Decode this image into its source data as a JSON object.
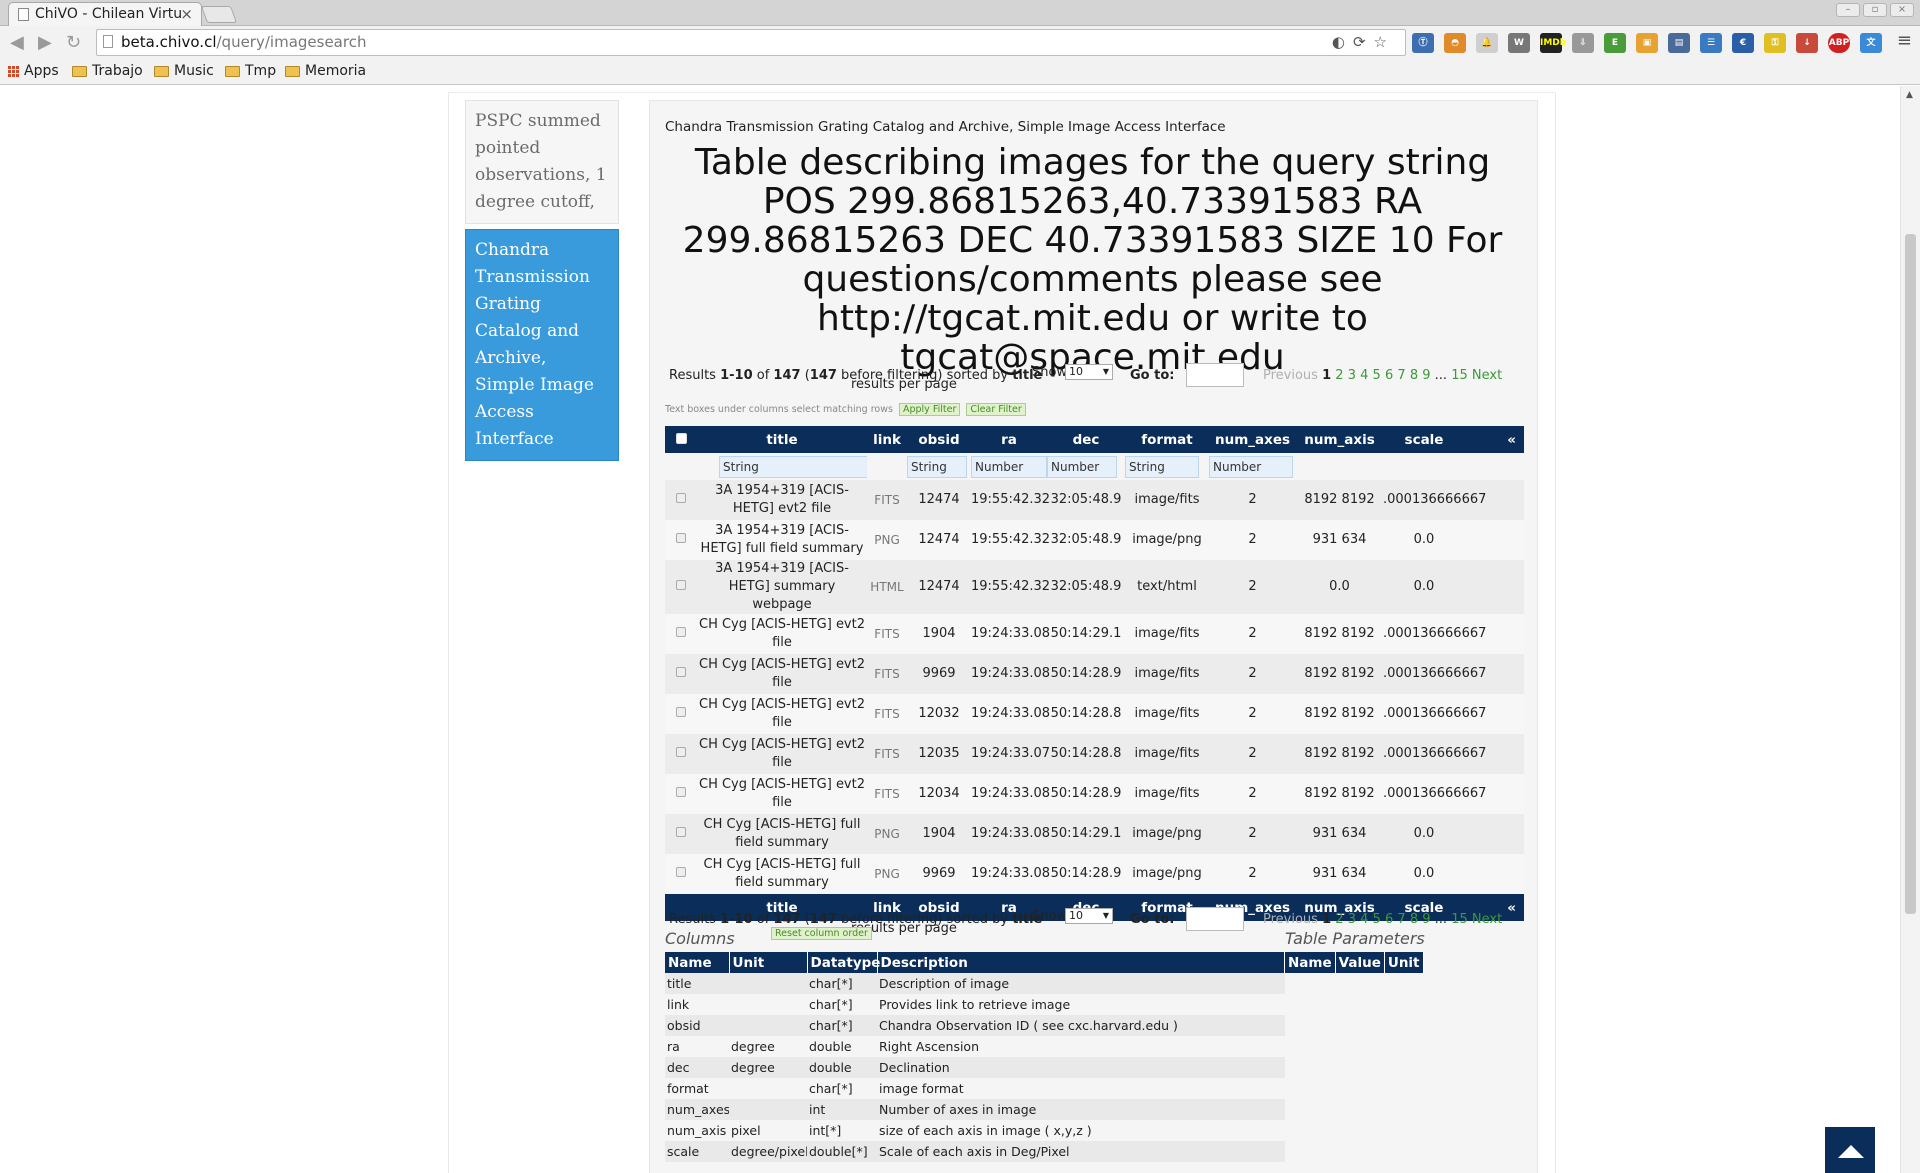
{
  "browser": {
    "tab_title": "ChiVO - Chilean Virtu",
    "url_host": "beta.chivo.cl",
    "url_path": "/query/imagesearch",
    "bookmarks": [
      "Apps",
      "Trabajo",
      "Music",
      "Tmp",
      "Memoria"
    ]
  },
  "sidebar": {
    "items": [
      {
        "label": "PSPC summed pointed observations, 1 degree cutoff,",
        "active": false
      },
      {
        "label": "Chandra Transmission Grating Catalog and Archive, Simple Image Access Interface",
        "active": true
      }
    ]
  },
  "main": {
    "subheading": "Chandra Transmission Grating Catalog and Archive, Simple Image Access Interface",
    "title": "Table describing images for the query string POS 299.86815263,40.73391583 RA 299.86815263 DEC 40.73391583 SIZE 10 For questions/comments please see http://tgcat.mit.edu or write to tgcat@space.mit.edu"
  },
  "results": {
    "prefix": "Results ",
    "range": "1-10",
    "of": " of ",
    "total": "147",
    "paren_open": " (",
    "before_count": "147",
    "before_text": " before filtering) sorted by ",
    "sort_col": "title",
    "show_label": "Show",
    "show_value": "10",
    "per_page": "results per page",
    "goto_label": "Go to:",
    "prev": "Previous",
    "current_page": "1",
    "pages": [
      "2",
      "3",
      "4",
      "5",
      "6",
      "7",
      "8",
      "9"
    ],
    "ellipsis": "...",
    "last_page": "15",
    "next": "Next"
  },
  "filter": {
    "hint": "Text boxes under columns select matching rows",
    "apply": "Apply Filter",
    "clear": "Clear Filter"
  },
  "table": {
    "headers": [
      "title",
      "link",
      "obsid",
      "ra",
      "dec",
      "format",
      "num_axes",
      "num_axis",
      "scale"
    ],
    "collapse": "«",
    "filters": {
      "title": "String",
      "obsid": "String",
      "ra": "Number",
      "dec": "Number",
      "format": "String",
      "num_axes": "Number"
    },
    "rows": [
      {
        "title": "3A 1954+319  [ACIS-HETG] evt2 file",
        "link": "FITS",
        "obsid": "12474",
        "ra": "19:55:42.32",
        "dec": "32:05:48.9",
        "format": "image/fits",
        "num_axes": "2",
        "num_axis": "8192 8192",
        "scale": ".000136666667"
      },
      {
        "title": "3A 1954+319  [ACIS-HETG] full field summary",
        "link": "PNG",
        "obsid": "12474",
        "ra": "19:55:42.32",
        "dec": "32:05:48.9",
        "format": "image/png",
        "num_axes": "2",
        "num_axis": "931 634",
        "scale": "0.0"
      },
      {
        "title": "3A 1954+319  [ACIS-HETG] summary webpage",
        "link": "HTML",
        "obsid": "12474",
        "ra": "19:55:42.32",
        "dec": "32:05:48.9",
        "format": "text/html",
        "num_axes": "2",
        "num_axis": "0.0",
        "scale": "0.0"
      },
      {
        "title": "CH Cyg [ACIS-HETG] evt2 file",
        "link": "FITS",
        "obsid": "1904",
        "ra": "19:24:33.08",
        "dec": "50:14:29.1",
        "format": "image/fits",
        "num_axes": "2",
        "num_axis": "8192 8192",
        "scale": ".000136666667"
      },
      {
        "title": "CH Cyg [ACIS-HETG] evt2 file",
        "link": "FITS",
        "obsid": "9969",
        "ra": "19:24:33.08",
        "dec": "50:14:28.9",
        "format": "image/fits",
        "num_axes": "2",
        "num_axis": "8192 8192",
        "scale": ".000136666667"
      },
      {
        "title": "CH Cyg [ACIS-HETG] evt2 file",
        "link": "FITS",
        "obsid": "12032",
        "ra": "19:24:33.08",
        "dec": "50:14:28.8",
        "format": "image/fits",
        "num_axes": "2",
        "num_axis": "8192 8192",
        "scale": ".000136666667"
      },
      {
        "title": "CH Cyg [ACIS-HETG] evt2 file",
        "link": "FITS",
        "obsid": "12035",
        "ra": "19:24:33.07",
        "dec": "50:14:28.8",
        "format": "image/fits",
        "num_axes": "2",
        "num_axis": "8192 8192",
        "scale": ".000136666667"
      },
      {
        "title": "CH Cyg [ACIS-HETG] evt2 file",
        "link": "FITS",
        "obsid": "12034",
        "ra": "19:24:33.08",
        "dec": "50:14:28.9",
        "format": "image/fits",
        "num_axes": "2",
        "num_axis": "8192 8192",
        "scale": ".000136666667"
      },
      {
        "title": "CH Cyg [ACIS-HETG] full field summary",
        "link": "PNG",
        "obsid": "1904",
        "ra": "19:24:33.08",
        "dec": "50:14:29.1",
        "format": "image/png",
        "num_axes": "2",
        "num_axis": "931 634",
        "scale": "0.0"
      },
      {
        "title": "CH Cyg [ACIS-HETG] full field summary",
        "link": "PNG",
        "obsid": "9969",
        "ra": "19:24:33.08",
        "dec": "50:14:28.9",
        "format": "image/png",
        "num_axes": "2",
        "num_axis": "931 634",
        "scale": "0.0"
      }
    ]
  },
  "columns_section": {
    "title": "Columns",
    "reset": "Reset column order",
    "headers": [
      "Name",
      "Unit",
      "Datatype",
      "Description"
    ],
    "rows": [
      [
        "title",
        "",
        "char[*]",
        "Description of image"
      ],
      [
        "link",
        "",
        "char[*]",
        "Provides link to retrieve image"
      ],
      [
        "obsid",
        "",
        "char[*]",
        "Chandra Observation ID ( see cxc.harvard.edu )"
      ],
      [
        "ra",
        "degree",
        "double",
        "Right Ascension"
      ],
      [
        "dec",
        "degree",
        "double",
        "Declination"
      ],
      [
        "format",
        "",
        "char[*]",
        "image format"
      ],
      [
        "num_axes",
        "",
        "int",
        "Number of axes in image"
      ],
      [
        "num_axis",
        "pixel",
        "int[*]",
        "size of each axis in image ( x,y,z )"
      ],
      [
        "scale",
        "degree/pixel",
        "double[*]",
        "Scale of each axis in Deg/Pixel"
      ]
    ]
  },
  "params_section": {
    "title": "Table Parameters",
    "headers": [
      "Name",
      "Value",
      "Unit"
    ]
  },
  "colors": {
    "header_navy": "#0b2d5a",
    "sidebar_active": "#3a9bdc",
    "pager_link": "#3a9a36"
  },
  "icons": {
    "back": "back-arrow-icon",
    "forward": "forward-arrow-icon",
    "reload": "reload-icon",
    "star": "bookmark-star-icon",
    "menu": "hamburger-menu-icon",
    "to_top": "scroll-to-top-icon"
  }
}
